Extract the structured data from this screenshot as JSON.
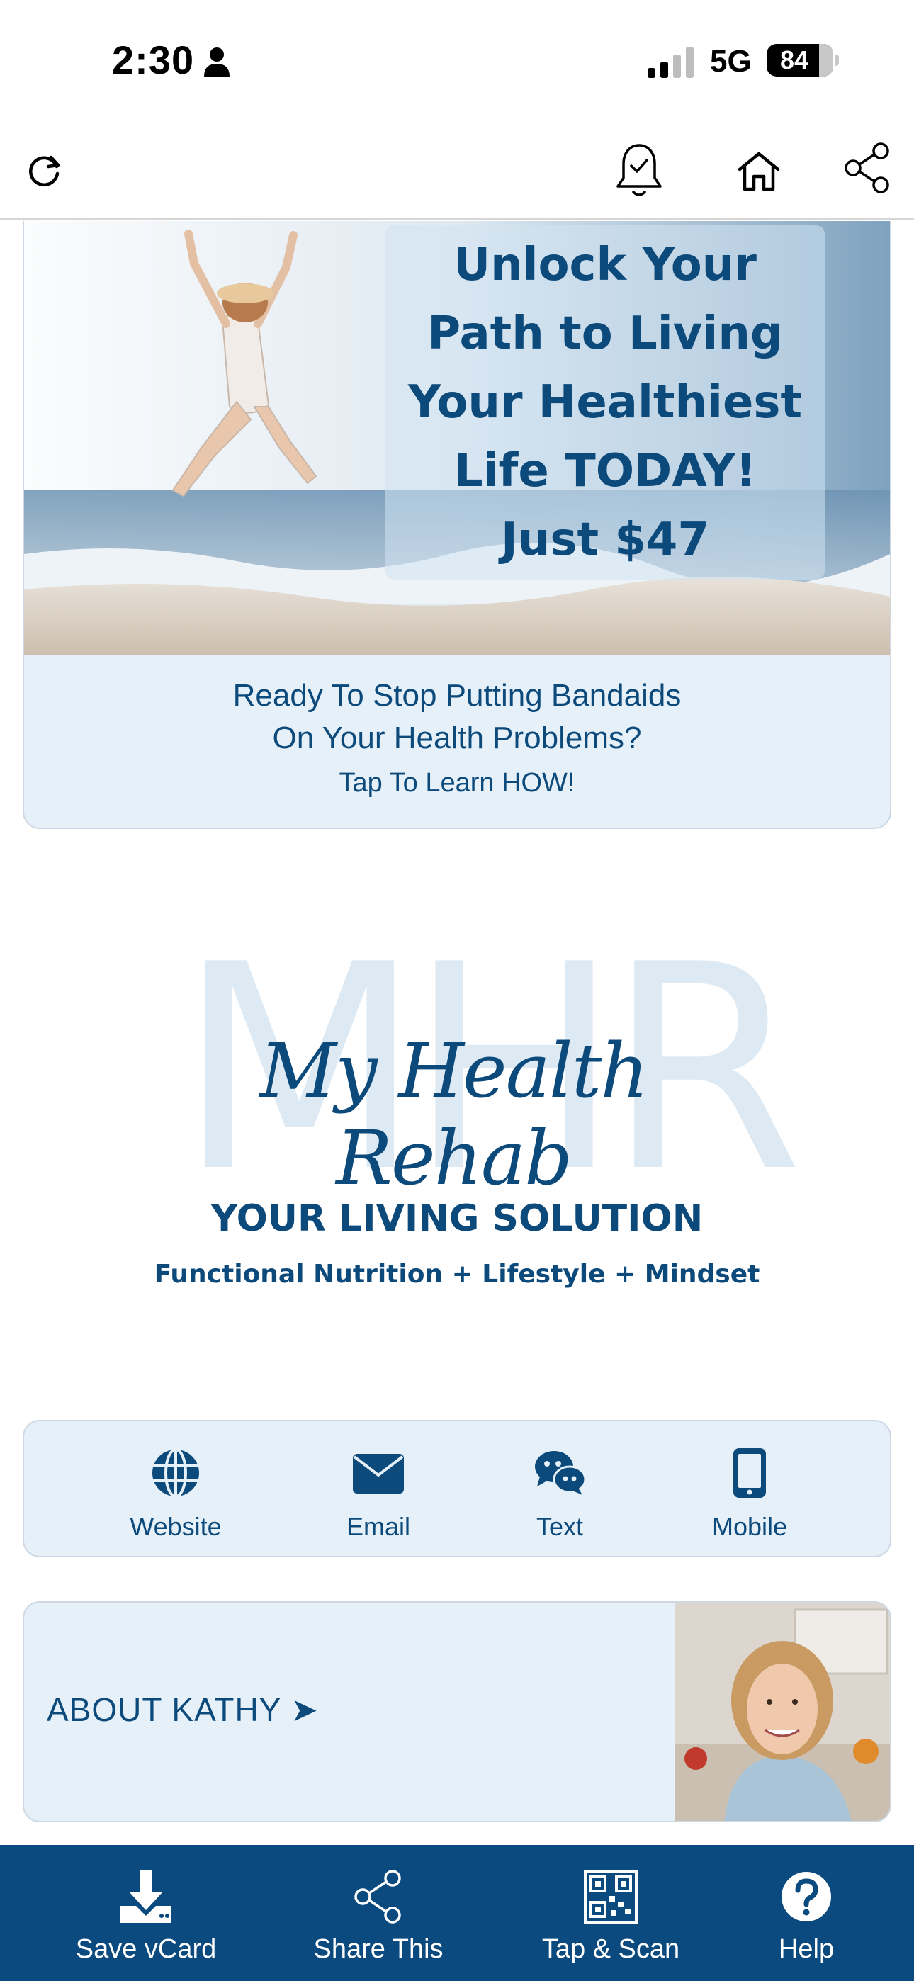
{
  "status_bar": {
    "time": "2:30",
    "network": "5G",
    "battery": "84"
  },
  "toolbar": {
    "icons": [
      "refresh-icon",
      "bell-check-icon",
      "home-icon",
      "share-icon"
    ]
  },
  "hero": {
    "headline_lines": [
      "Unlock Your",
      "Path to Living",
      "Your Healthiest",
      "Life TODAY!",
      "Just $47"
    ],
    "caption_line1": "Ready To Stop Putting Bandaids",
    "caption_line2": "On Your Health Problems?",
    "caption_cta": "Tap To Learn HOW!"
  },
  "logo": {
    "monogram": "MHR",
    "script_name": "My Health Rehab",
    "tagline": "YOUR LIVING SOLUTION",
    "subline": "Functional Nutrition + Lifestyle + Mindset"
  },
  "contacts": [
    {
      "label": "Website",
      "icon": "globe-icon"
    },
    {
      "label": "Email",
      "icon": "envelope-icon"
    },
    {
      "label": "Text",
      "icon": "chat-bubbles-icon"
    },
    {
      "label": "Mobile",
      "icon": "phone-icon"
    }
  ],
  "about": {
    "label": "ABOUT KATHY ➤"
  },
  "bottom_nav": [
    {
      "label": "Save vCard",
      "icon": "download-icon"
    },
    {
      "label": "Share This",
      "icon": "share-icon"
    },
    {
      "label": "Tap & Scan",
      "icon": "qr-code-icon"
    },
    {
      "label": "Help",
      "icon": "help-icon"
    }
  ],
  "colors": {
    "brand_blue": "#0b4a7e",
    "card_bg": "#e6f0f8",
    "card_border": "#cdd8e2"
  }
}
